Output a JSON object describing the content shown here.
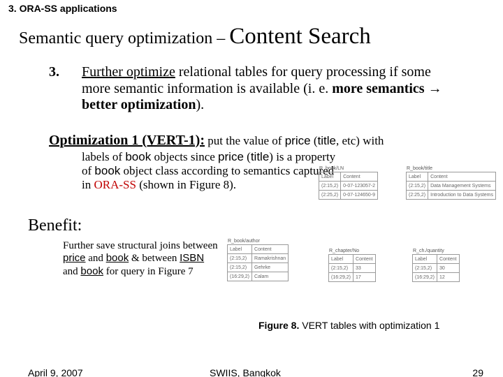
{
  "header_small": "3. ORA-SS applications",
  "title_part1": "Semantic query optimization – ",
  "title_part2": "Content Search",
  "list_number": "3.",
  "point3_a": "Further optimize",
  "point3_b": " relational tables for query processing if some more semantic information is available (i. e. ",
  "point3_c": "more semantics",
  "arrow": " → ",
  "point3_d": "better optimization",
  "point3_e": ").",
  "opt_lead": "Optimization 1 (VERT-1):",
  "opt_tail_a": " put the value of ",
  "w_price": "price",
  "opt_tail_b": " (",
  "w_title": "title",
  "opt_tail_c": ", etc) with",
  "optdesc_a": "labels of ",
  "w_book": "book",
  "optdesc_b": " objects since ",
  "optdesc_c": " (",
  "optdesc_d": ") is a property of ",
  "optdesc_e": " object class according to semantics captured in ",
  "w_orass": "ORA-SS",
  "optdesc_f": " (shown in Figure 8).",
  "benefit_title": "Benefit:",
  "benefit_a": "Further save structural joins between ",
  "benefit_b": " and ",
  "benefit_c": " & between ",
  "w_isbn": "ISBN",
  "benefit_d": " and ",
  "benefit_e": " for query in Figure 7",
  "fig_caption_a": "Figure 8.",
  "fig_caption_b": " VERT tables with optimization 1",
  "footer_date": "April 9, 2007",
  "footer_venue": "SWIIS, Bangkok",
  "footer_page": "29",
  "tables1": {
    "left": {
      "name": "R_book/LN",
      "h1": "Label",
      "h2": "Content",
      "r1c1": "(2:15,2)",
      "r1c2": "0-07-123057-2",
      "r2c1": "(2:25,2)",
      "r2c2": "0-07-124650-9"
    },
    "right": {
      "name": "R_book/title",
      "h1": "Label",
      "h2": "Content",
      "r1c1": "(2:15,2)",
      "r1c2": "Data Management Systems",
      "r2c1": "(2:25,2)",
      "r2c2": "Introduction to Data Systems"
    }
  },
  "tables2": {
    "t1": {
      "name": "R_book/author",
      "h1": "Label",
      "h2": "Content",
      "r1c1": "(2:15,2)",
      "r1c2": "Ramakrishnan",
      "r2c1": "(2:15,2)",
      "r2c2": "Gehrke",
      "r3c1": "(16:29,2)",
      "r3c2": "Calam"
    },
    "t2": {
      "name": "R_chapter/No",
      "h1": "Label",
      "h2": "Content",
      "r1c1": "(2:15,2)",
      "r1c2": "33",
      "r2c1": "(16:29,2)",
      "r2c2": "17"
    },
    "t3": {
      "name": "R_ch./quantity",
      "h1": "Label",
      "h2": "Content",
      "r1c1": "(2:15,2)",
      "r1c2": "30",
      "r2c1": "(16:29,2)",
      "r2c2": "12"
    }
  }
}
